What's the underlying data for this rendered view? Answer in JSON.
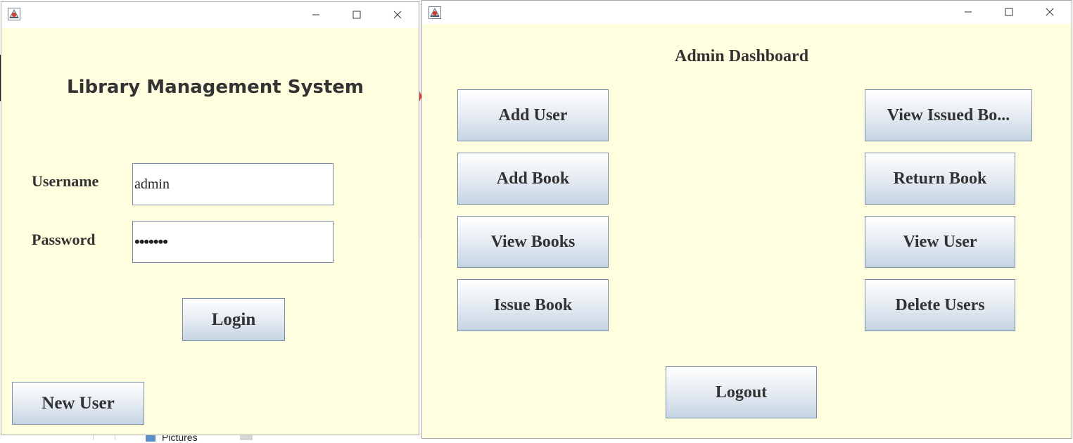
{
  "desktop": {
    "explorer_folder_label": "Pictures"
  },
  "login_window": {
    "title_icon": "java-app-icon",
    "heading": "Library Management System",
    "username_label": "Username",
    "username_value": "admin",
    "password_label": "Password",
    "password_value": "•••••••",
    "login_button": "Login",
    "new_user_button": "New User"
  },
  "admin_window": {
    "title_icon": "java-app-icon",
    "heading": "Admin Dashboard",
    "buttons": {
      "add_user": "Add User",
      "add_book": "Add Book",
      "view_books": "View Books",
      "issue_book": "Issue Book",
      "view_issued_books": "View Issued Bo...",
      "return_book": "Return Book",
      "view_user": "View User",
      "delete_users": "Delete Users",
      "logout": "Logout"
    }
  },
  "colors": {
    "client_background": "#ffffe0",
    "button_gradient_top": "#ffffff",
    "button_gradient_bottom": "#c5d4e3",
    "text": "#333333"
  }
}
